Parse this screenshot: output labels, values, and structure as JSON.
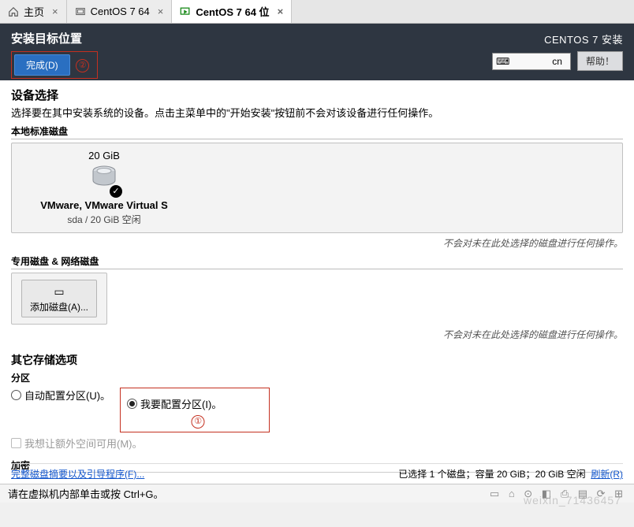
{
  "tabs": {
    "home": "主页",
    "t1": "CentOS 7 64",
    "t2": "CentOS 7 64 位"
  },
  "banner": {
    "title": "安装目标位置",
    "done": "完成(D)",
    "annot2": "②",
    "product": "CENTOS 7 安装",
    "kbd": "cn",
    "help": "帮助！"
  },
  "main": {
    "device_selection": "设备选择",
    "device_desc": "选择要在其中安装系统的设备。点击主菜单中的\"开始安装\"按钮前不会对该设备进行任何操作。",
    "local_disks": "本地标准磁盘",
    "disk": {
      "size": "20 GiB",
      "name": "VMware, VMware Virtual S",
      "sub": "sda   /   20 GiB 空闲"
    },
    "hint": "不会对未在此处选择的磁盘进行任何操作。",
    "special_disks": "专用磁盘 & 网络磁盘",
    "add_disk": "添加磁盘(A)...",
    "other_storage": "其它存储选项",
    "partitioning": "分区",
    "opt_auto": "自动配置分区(U)。",
    "opt_manual": "我要配置分区(I)。",
    "annot1": "①",
    "opt_extra": "我想让额外空间可用(M)。",
    "encryption": "加密",
    "summary_link": "完整磁盘摘要以及引导程序(F)...",
    "selected_status": "已选择 1 个磁盘；容量 20 GiB；20 GiB 空闲",
    "refresh": "刷新(R)"
  },
  "vm_status": {
    "hint": "请在虚拟机内部单击或按 Ctrl+G。"
  },
  "watermark": "weixin_71436457"
}
